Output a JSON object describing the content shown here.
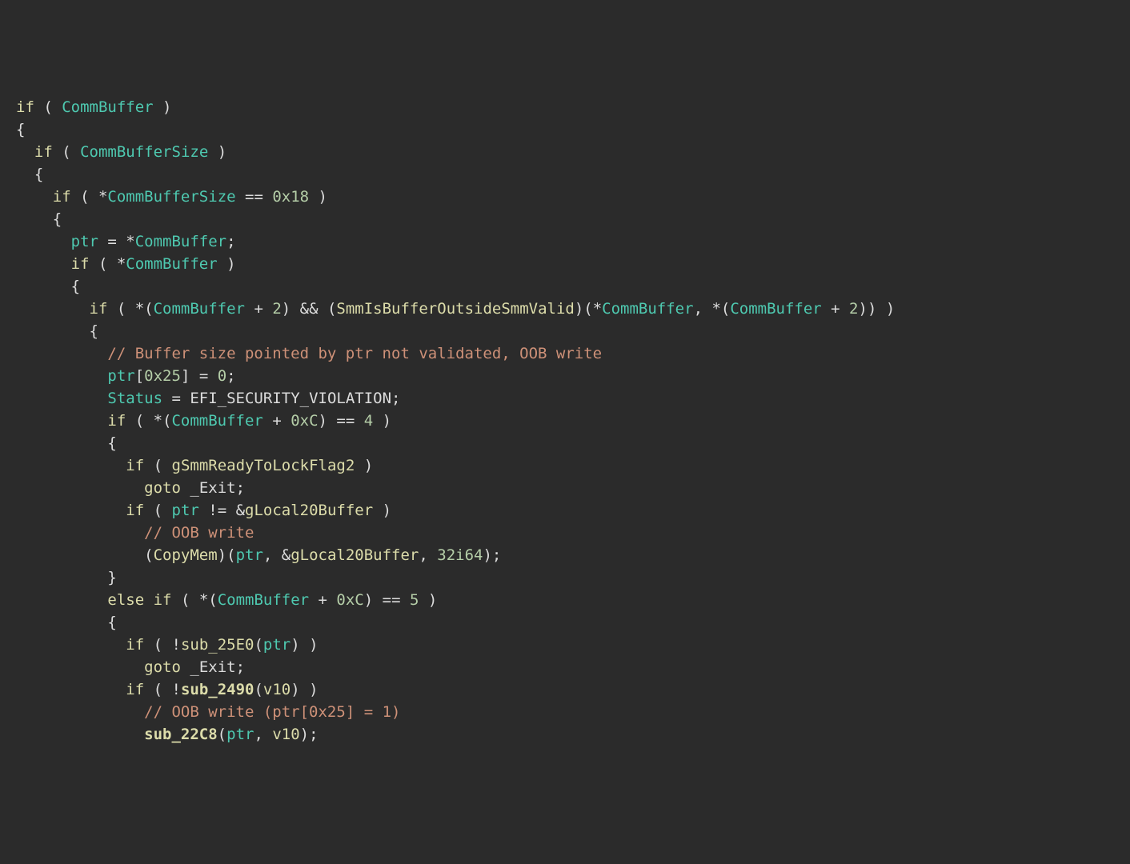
{
  "tokens": {
    "if": "if",
    "else": "else",
    "goto": "goto",
    "CommBuffer": "CommBuffer",
    "CommBufferSize": "CommBufferSize",
    "ptr": "ptr",
    "Status": "Status",
    "SmmIsBufferOutsideSmmValid": "SmmIsBufferOutsideSmmValid",
    "EFI_SECURITY_VIOLATION": "EFI_SECURITY_VIOLATION",
    "gSmmReadyToLockFlag2": "gSmmReadyToLockFlag2",
    "Exit": "_Exit",
    "gLocal20Buffer": "gLocal20Buffer",
    "CopyMem": "CopyMem",
    "sub_25E0": "sub_25E0",
    "sub_2490": "sub_2490",
    "sub_22C8": "sub_22C8",
    "v10": "v10"
  },
  "nums": {
    "h18": "0x18",
    "h25": "0x25",
    "hC": "0xC",
    "zero": "0",
    "two": "2",
    "four": "4",
    "five": "5",
    "i32": "32i64"
  },
  "comments": {
    "c1": "// Buffer size pointed by ptr not validated, OOB write",
    "c2": "// OOB write",
    "c3": "// OOB write (ptr[0x25] = 1)"
  }
}
